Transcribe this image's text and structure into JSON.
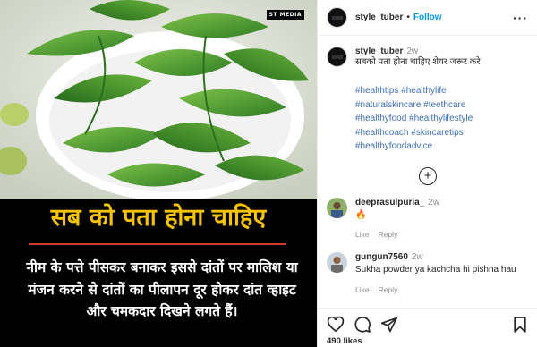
{
  "post": {
    "brand_badge": "ST MEDIA",
    "headline": "सब को पता होना चाहिए",
    "body": "नीम के पत्ते पीसकर बनाकर इससे दांतों पर मालिश या मंजन करने से दांतों का पीलापन दूर होकर दांत व्हाइट और चमकदार दिखने लगते हैं।"
  },
  "header": {
    "username": "style_tuber",
    "dot": "•",
    "follow_label": "Follow",
    "more_label": "···"
  },
  "caption": {
    "username": "style_tuber",
    "time": "2w",
    "text": "सबको पता होना चाहिए शेयर जरूर करे",
    "hashtags": [
      "#healthtips #healthylife",
      "#naturalskincare #teethcare",
      "#healthyfood #healthylifestyle",
      "#healthcoach #skincaretips",
      "#healthyfoodadvice"
    ],
    "load_more": "+"
  },
  "comments": [
    {
      "username": "deeprasulpuria_",
      "time": "2w",
      "text": "🔥",
      "like": "Like",
      "reply": "Reply"
    },
    {
      "username": "gungun7560",
      "time": "2w",
      "text": "Sukha powder ya kachcha hi pishna hau",
      "like": "Like",
      "reply": "Reply"
    }
  ],
  "footer": {
    "likes": "490 likes"
  },
  "icons": {
    "like": "heart-icon",
    "comment": "comment-icon",
    "share": "share-icon",
    "save": "bookmark-icon",
    "more": "more-icon",
    "load": "plus-circle-icon"
  }
}
